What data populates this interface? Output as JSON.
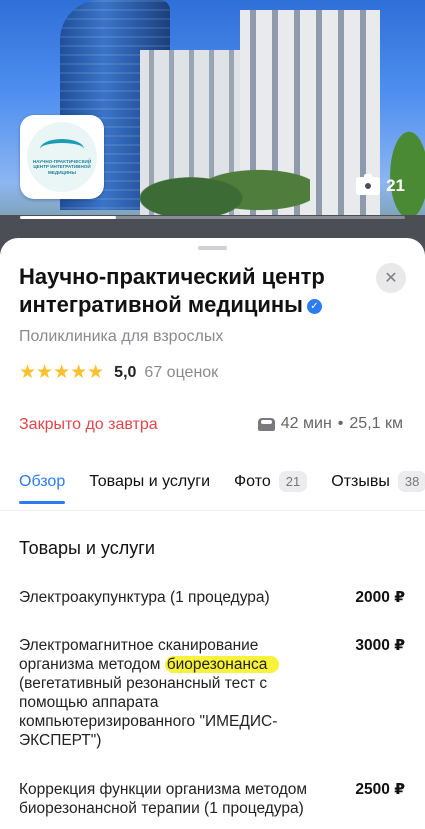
{
  "hero": {
    "logo_text": "НАУЧНО-ПРАКТИЧЕСКИЙ ЦЕНТР ИНТЕГРАТИВНОЙ МЕДИЦИНЫ",
    "photo_count": "21",
    "photo_progress": 0.25
  },
  "org": {
    "title": "Научно-практический центр интегративной медицины",
    "category": "Поликлиника для взрослых",
    "stars": "★★★★★",
    "rating": "5,0",
    "reviews": "67 оценок",
    "status": "Закрыто до завтра",
    "route_time": "42 мин",
    "route_sep": "•",
    "route_distance": "25,1 км",
    "verified_icon": "✓",
    "close_icon": "✕"
  },
  "tabs": [
    {
      "label": "Обзор",
      "active": true
    },
    {
      "label": "Товары и услуги"
    },
    {
      "label": "Фото",
      "badge": "21"
    },
    {
      "label": "Отзывы",
      "badge": "38"
    }
  ],
  "services": {
    "title": "Товары и услуги",
    "items": [
      {
        "name": "Электроакупунктура (1 процедура)",
        "price": "2000 ₽"
      },
      {
        "name_before": "Электромагнитное сканирование организма методом ",
        "name_highlight": "биорезонанса",
        "name_after": " (вегетативный резонансный тест с помощью аппарата компьютеризированного \"ИМЕДИС-ЭКСПЕРТ\")",
        "price": "3000 ₽"
      },
      {
        "name": "Коррекция функции организма методом биорезонансной терапии (1 процедура)",
        "price": "2500 ₽"
      }
    ]
  },
  "colors": {
    "accent": "#2b7cf0",
    "closed": "#e0464a",
    "stars": "#fbc02d",
    "highlight": "#f7f23a"
  }
}
